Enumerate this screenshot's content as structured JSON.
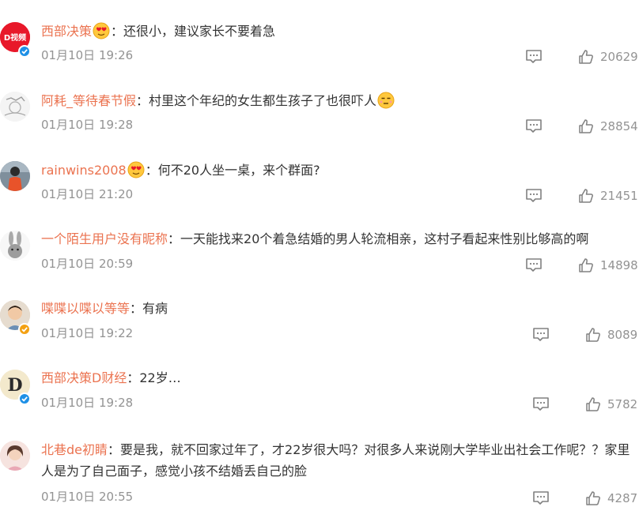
{
  "colors": {
    "username": "#eb7350",
    "meta": "#939393",
    "text": "#333333",
    "verify_blue": "#1e90e6",
    "verify_gold": "#f3a113"
  },
  "icons": {
    "comment": "comment-icon",
    "like": "thumbs-up-icon"
  },
  "comments": [
    {
      "username": "西部决策",
      "colon": "：",
      "text": "还很小，建议家长不要着急",
      "time": "01月10日 19:26",
      "likes": "20629",
      "avatar_icon": "video-channel-logo-icon",
      "avatar_logo_text": "D视频",
      "verified": "blue",
      "emoji_after_name": "heart-eyes-emoji-icon",
      "emoji_after_text": ""
    },
    {
      "username": "阿耗_等待春节假",
      "colon": "：",
      "text": "村里这个年纪的女生都生孩子了也很吓人",
      "time": "01月10日 19:28",
      "likes": "28854",
      "avatar_icon": "sketch-avatar-icon",
      "verified": "",
      "emoji_after_name": "",
      "emoji_after_text": "speechless-face-emoji-icon"
    },
    {
      "username": "rainwins2008",
      "colon": "：",
      "text": "何不20人坐一桌，来个群面?",
      "time": "01月10日 21:20",
      "likes": "21451",
      "avatar_icon": "runner-avatar-icon",
      "verified": "",
      "emoji_after_name": "heart-eyes-emoji-icon",
      "emoji_after_text": ""
    },
    {
      "username": "一个陌生用户没有昵称",
      "colon": "：",
      "text": "一天能找来20个着急结婚的男人轮流相亲，这村子看起来性别比够高的啊",
      "time": "01月10日 20:59",
      "likes": "14898",
      "avatar_icon": "rabbit-avatar-icon",
      "verified": "",
      "emoji_after_name": "",
      "emoji_after_text": ""
    },
    {
      "username": "喋喋以喋以等等",
      "colon": "：",
      "text": "有病",
      "time": "01月10日 19:22",
      "likes": "8089",
      "avatar_icon": "child-photo-avatar-icon",
      "verified": "gold",
      "emoji_after_name": "",
      "emoji_after_text": ""
    },
    {
      "username": "西部决策D财经",
      "colon": "：",
      "text": "22岁…",
      "time": "01月10日 19:28",
      "likes": "5782",
      "avatar_icon": "letter-d-logo-icon",
      "verified": "blue",
      "emoji_after_name": "",
      "emoji_after_text": ""
    },
    {
      "username": "北巷de初睛",
      "colon": "：",
      "text": "要是我，就不回家过年了，才22岁很大吗？对很多人来说刚大学毕业出社会工作呢？？家里人是为了自己面子，感觉小孩不结婚丢自己的脸",
      "time": "01月10日 20:55",
      "likes": "4287",
      "avatar_icon": "girl-photo-avatar-icon",
      "verified": "",
      "emoji_after_name": "",
      "emoji_after_text": ""
    }
  ]
}
